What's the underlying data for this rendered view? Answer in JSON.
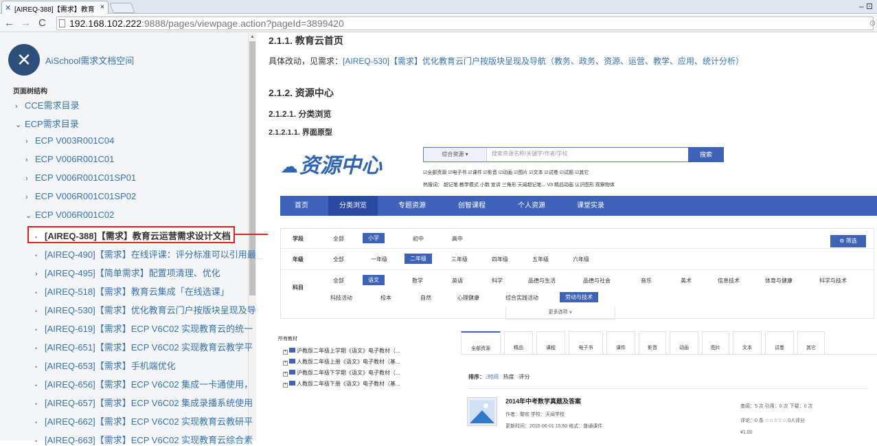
{
  "browser": {
    "tab_title": "[AIREQ-388]【需求】教育",
    "tab_close": "×",
    "window_controls": "– ⊡",
    "url_host": "192.168.102.222",
    "url_rest": ":9888/pages/viewpage.action?pageId=3899420"
  },
  "sidebar": {
    "space_name": "AiSchool需求文档空间",
    "tree_heading": "页面树结构",
    "items": [
      {
        "label": "CCE需求目录",
        "marker": "›"
      },
      {
        "label": "ECP需求目录",
        "marker": "⌄"
      },
      {
        "label": "ECP V003R001C04",
        "marker": "›"
      },
      {
        "label": "ECP V006R001C01",
        "marker": "›"
      },
      {
        "label": "ECP V006R001C01SP01",
        "marker": "›"
      },
      {
        "label": "ECP V006R001C01SP02",
        "marker": "›"
      },
      {
        "label": "ECP V006R001C02",
        "marker": "⌄"
      },
      {
        "label": "[AIREQ-388]【需求】教育云运营需求设计文档",
        "marker": "•"
      },
      {
        "label": "[AIREQ-490]【需求】在线评课：评分标准可以引用最",
        "marker": "•"
      },
      {
        "label": "[AIREQ-495]【简单需求】配置项清理、优化",
        "marker": "›"
      },
      {
        "label": "[AIREQ-518]【需求】教育云集成「在线选课」",
        "marker": "•"
      },
      {
        "label": "[AIREQ-530]【需求】优化教育云门户按版块呈现及导",
        "marker": "•"
      },
      {
        "label": "[AIREQ-619]【需求】ECP V6C02 实现教育云的统一",
        "marker": "•"
      },
      {
        "label": "[AIREQ-651]【需求】ECP V6C02 实现教育云教学平",
        "marker": "•"
      },
      {
        "label": "[AIREQ-653]【需求】手机端优化",
        "marker": "•"
      },
      {
        "label": "[AIREQ-656]【需求】ECP V6C02 集成一卡通使用，",
        "marker": "•"
      },
      {
        "label": "[AIREQ-657]【需求】ECP V6C02 集成录播系统使用",
        "marker": "•"
      },
      {
        "label": "[AIREQ-662]【需求】ECP V6C02 实现教育云教研平",
        "marker": "•"
      },
      {
        "label": "[AIREQ-663]【需求】ECP V6C02 实现教育云综合素",
        "marker": "•"
      }
    ]
  },
  "main": {
    "h_211": "2.1.1. 教育云首页",
    "p_211_prefix": "具体改动，见需求：",
    "p_211_link": "[AIREQ-530]【需求】优化教育云门户按版块呈现及导航（教务、政务、资源、运营、教学、应用、统计分析）",
    "h_212": "2.1.2. 资源中心",
    "h_2121": "2.1.2.1. 分类浏览",
    "h_21211": "2.1.2.1.1. 界面原型"
  },
  "mockup": {
    "logo_icon": "cloud-icon",
    "logo_text": "资源中心",
    "search_type": "综合资源 ▾",
    "search_placeholder": "搜索资源名称/关键字/作者/学校",
    "search_btn": "搜索",
    "checks": "☑全部资源 ☑电子书 ☑课件 ☑影音 ☑动画 ☑图片 ☑文本 ☑试卷 ☑试题 ☑其它",
    "hot": "热搜词：  超记笔  教学模式  小数  宣讲  三角形  天闻超记笔...  V3  精品动画  认识图形  观察物体",
    "nav": [
      "首页",
      "分类浏览",
      "专题资源",
      "创智课程",
      "个人资源",
      "课堂实录"
    ],
    "stage_label": "学段",
    "stages": [
      "全部",
      "小学",
      "初中",
      "高中"
    ],
    "filter_btn": "⚙ 筛选",
    "grade_label": "年级",
    "grades": [
      "全部",
      "一年级",
      "二年级",
      "三年级",
      "四年级",
      "五年级",
      "六年级"
    ],
    "subject_label": "科目",
    "subjects_row1": [
      "全部",
      "语文",
      "数学",
      "英语",
      "科学",
      "品德与生活",
      "品德与社会",
      "音乐",
      "美术",
      "信息技术",
      "体育与健康",
      "科学与技术"
    ],
    "subjects_row2": [
      "科技活动",
      "校本",
      "自然",
      "心理健康",
      "综合实践活动",
      "劳动与技术"
    ],
    "more": "更多选项 ∨",
    "all_books": "所有教材",
    "books": [
      "沪教版二年级上学期《语文》电子教材（...",
      "人教版二年级上册《语文》电子教材（基...",
      "沪教版二年级下学期《语文》电子教材（...",
      "人教版二年级下册《语文》电子教材（基..."
    ],
    "res_tabs": [
      "全部资源",
      "精品",
      "课程",
      "电子书",
      "课件",
      "影音",
      "动画",
      "图片",
      "文本",
      "试卷",
      "其它"
    ],
    "sort_label": "排序：",
    "sort_time": "↓时间",
    "sort_hot": "热度",
    "sort_score": "评分",
    "res_title": "2014年中考数学真题及答案",
    "res_author": "作者：黎欢    学校：天闻学校",
    "res_time": "更新时间：2015-06-01 15:50      格式：普通课件",
    "res_stat1": "查阅：5 次    引用：0 次    下载：0 次",
    "res_stat2": "评论：0 条    ☆☆☆☆☆ 0人评分",
    "res_price": "¥1.00"
  }
}
